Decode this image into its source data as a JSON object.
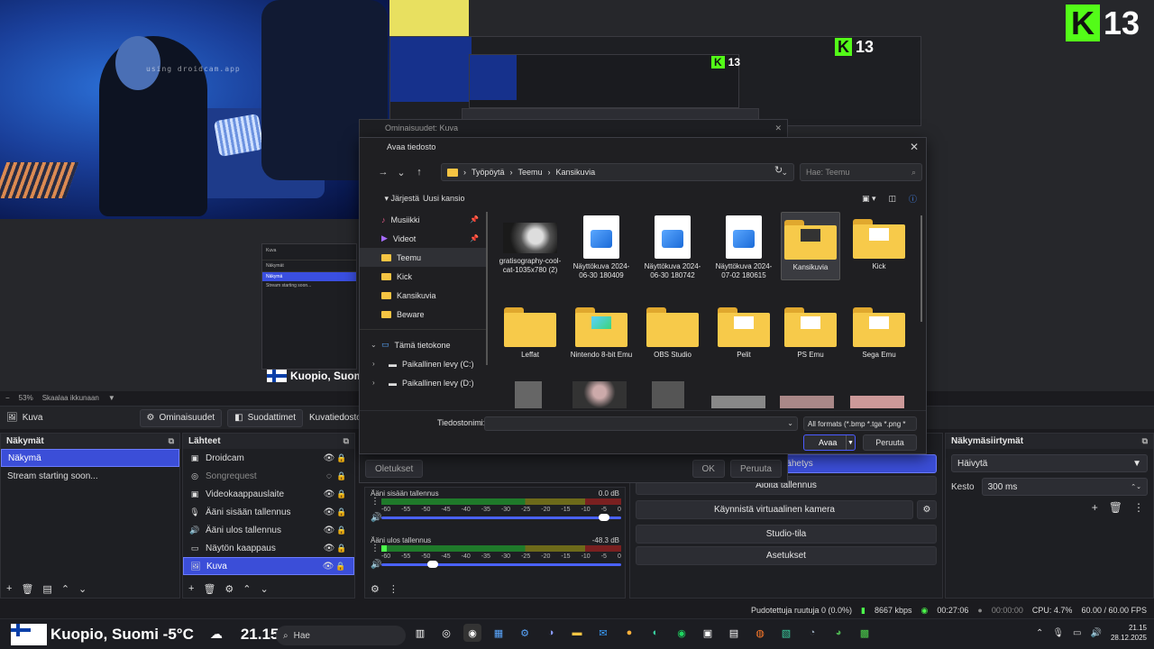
{
  "preview": {
    "droidcam_label": "using droidcam.app",
    "kick_number": "13",
    "kick_letter": "K",
    "location_overlay": "Kuopio, Suomi",
    "mini_obs": {
      "tab": "Kuva",
      "scenes_title": "Näkymät",
      "scene_selected": "Näkymä",
      "scene_other": "Stream starting soon..."
    }
  },
  "zoom": {
    "level": "53%",
    "mode": "Skaalaa ikkunaan"
  },
  "context_bar": {
    "source": "Kuva",
    "properties": "Ominaisuudet",
    "filters": "Suodattimet",
    "image_file": "Kuvatiedosto"
  },
  "scenes_dock": {
    "title": "Näkymät",
    "items": [
      "Näkymä",
      "Stream starting soon..."
    ]
  },
  "sources_dock": {
    "title": "Lähteet",
    "items": [
      {
        "name": "Droidcam",
        "icon": "camera-icon",
        "visible": true
      },
      {
        "name": "Songrequest",
        "icon": "browser-icon",
        "visible": false
      },
      {
        "name": "Videokaappauslaite",
        "icon": "camera-icon",
        "visible": true
      },
      {
        "name": "Ääni sisään tallennus",
        "icon": "mic-icon",
        "visible": true
      },
      {
        "name": "Ääni ulos tallennus",
        "icon": "speaker-icon",
        "visible": true
      },
      {
        "name": "Näytön kaappaus",
        "icon": "monitor-icon",
        "visible": true
      },
      {
        "name": "Kuva",
        "icon": "image-icon",
        "visible": true
      }
    ]
  },
  "mixer": {
    "channels": [
      {
        "name": "Ääni sisään tallennus",
        "db": "0.0 dB",
        "level": 0.0,
        "fader": 0.95
      },
      {
        "name": "Ääni ulos tallennus",
        "db": "-48.3 dB",
        "level": 0.02,
        "fader": 0.2
      }
    ],
    "ticks": [
      "-60",
      "-55",
      "-50",
      "-45",
      "-40",
      "-35",
      "-30",
      "-25",
      "-20",
      "-15",
      "-10",
      "-5",
      "0"
    ]
  },
  "controls": {
    "broadcast": "Aloita lähetys",
    "record": "Aloita tallennus",
    "virtual_cam": "Käynnistä virtuaalinen kamera",
    "studio": "Studio-tila",
    "settings": "Asetukset"
  },
  "transitions": {
    "title": "Näkymäsiirtymät",
    "selected": "Häivytä",
    "duration_label": "Kesto",
    "duration": "300 ms"
  },
  "properties_dialog": {
    "title": "Ominaisuudet: Kuva",
    "defaults": "Oletukset",
    "ok": "OK",
    "cancel": "Peruuta"
  },
  "file_dialog": {
    "title": "Avaa tiedosto",
    "path": [
      "Työpöytä",
      "Teemu",
      "Kansikuvia"
    ],
    "search_placeholder": "Hae: Teemu",
    "new_folder": "Uusi kansio",
    "organize": "Järjestä",
    "sidebar": [
      {
        "label": "Musiikki",
        "pinned": true,
        "icon": "music-icon"
      },
      {
        "label": "Videot",
        "pinned": true,
        "icon": "video-icon"
      },
      {
        "label": "Teemu",
        "pinned": false,
        "icon": "folder-icon",
        "selected": true
      },
      {
        "label": "Kick",
        "pinned": false,
        "icon": "folder-icon"
      },
      {
        "label": "Kansikuvia",
        "pinned": false,
        "icon": "folder-icon"
      },
      {
        "label": "Beware",
        "pinned": false,
        "icon": "folder-icon"
      }
    ],
    "this_pc": "Tämä tietokone",
    "drives": [
      "Paikallinen levy (C:)",
      "Paikallinen levy (D:)"
    ],
    "files": [
      {
        "label": "gratisography-cool-cat-1035x780 (2)",
        "type": "photo"
      },
      {
        "label": "Näyttökuva 2024-06-30 180409",
        "type": "image"
      },
      {
        "label": "Näyttökuva 2024-06-30 180742",
        "type": "image"
      },
      {
        "label": "Näyttökuva 2024-07-02 180615",
        "type": "image"
      },
      {
        "label": "Kansikuvia",
        "type": "folder",
        "selected": true
      },
      {
        "label": "Kick",
        "type": "folder"
      },
      {
        "label": "Leffat",
        "type": "folder"
      },
      {
        "label": "Nintendo 8-bit Emu",
        "type": "folder"
      },
      {
        "label": "OBS Studio",
        "type": "folder"
      },
      {
        "label": "Pelit",
        "type": "folder"
      },
      {
        "label": "PS Emu",
        "type": "folder"
      },
      {
        "label": "Sega Emu",
        "type": "folder"
      }
    ],
    "filename_label": "Tiedostonimi:",
    "filename_value": "",
    "filter": "All formats (*.bmp *.tga *.png *",
    "open": "Avaa",
    "cancel": "Peruuta"
  },
  "status": {
    "dropped": "Pudotettuja ruutuja 0 (0.0%)",
    "bitrate": "8667 kbps",
    "stream_time": "00:27:06",
    "rec_time": "00:00:00",
    "cpu": "CPU: 4.7%",
    "fps": "60.00 / 60.00 FPS"
  },
  "taskbar": {
    "weather": "Kuopio, Suomi -5°C",
    "clock_overlay": "21.15",
    "search": "Hae",
    "time": "21.15",
    "date": "28.12.2025"
  }
}
